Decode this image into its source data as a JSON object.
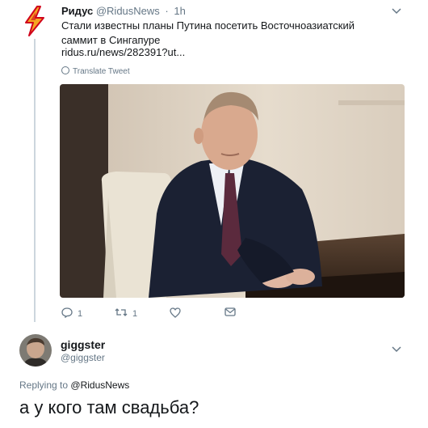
{
  "tweet": {
    "author_name": "Ридус",
    "author_handle": "@RidusNews",
    "separator": "·",
    "time": "1h",
    "text": "Стали известны планы Путина посетить Восточноазиатский саммит в Сингапуре",
    "link": "ridus.ru/news/282391?ut...",
    "translate_label": "Translate Tweet",
    "actions": {
      "reply_count": "1",
      "retweet_count": "1"
    }
  },
  "reply": {
    "author_name": "giggster",
    "author_handle": "@giggster",
    "replying_prefix": "Replying to",
    "replying_to": "@RidusNews",
    "text": "а у кого там свадьба?"
  },
  "colors": {
    "primary_text": "#14171a",
    "secondary_text": "#657786",
    "thread_line": "#ccd6dd",
    "ridus_logo": "#f5a623",
    "ridus_bolt": "#d0021b"
  }
}
